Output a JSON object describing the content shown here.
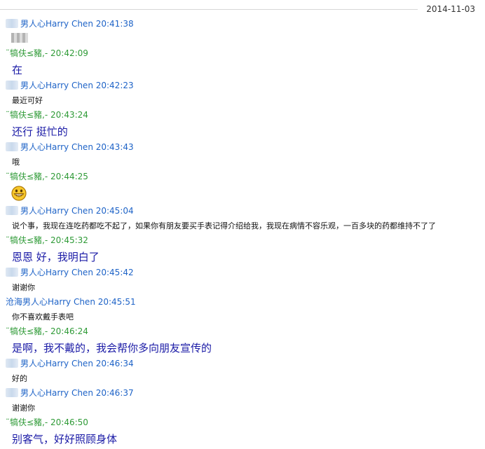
{
  "date": "2014-11-03",
  "contacts": {
    "them": "男人心Harry Chen",
    "them_full": "沧海男人心Harry Chen",
    "me": "¨犒伕≤豬,-"
  },
  "entries": [
    {
      "header": "男人心Harry Chen 20:41:38"
    },
    {
      "header": "¨犒伕≤豬,- 20:42:09",
      "text": "在"
    },
    {
      "header": "男人心Harry Chen 20:42:23",
      "text": "最近可好"
    },
    {
      "header": "¨犒伕≤豬,- 20:43:24",
      "text": "还行 挺忙的"
    },
    {
      "header": "男人心Harry Chen 20:43:43",
      "text": "哦"
    },
    {
      "header": "¨犒伕≤豬,- 20:44:25",
      "icon": "grinning-smiley-icon"
    },
    {
      "header": "男人心Harry Chen 20:45:04",
      "text": "说个事，我现在连吃药都吃不起了，如果你有朋友要买手表记得介绍给我，我现在病情不容乐观，一百多块的药都维持不了了"
    },
    {
      "header": "¨犒伕≤豬,- 20:45:32",
      "text": "恩恩 好，我明白了"
    },
    {
      "header": "男人心Harry Chen 20:45:42",
      "text": "谢谢你"
    },
    {
      "header": "沧海男人心Harry Chen 20:45:51",
      "text": "你不喜欢戴手表吧"
    },
    {
      "header": "¨犒伕≤豬,- 20:46:24",
      "text": "是啊，我不戴的，我会帮你多向朋友宣传的"
    },
    {
      "header": "男人心Harry Chen 20:46:34",
      "text": "好的"
    },
    {
      "header": "男人心Harry Chen 20:46:37",
      "text": "谢谢你"
    },
    {
      "header": "¨犒伕≤豬,- 20:46:50",
      "text": "别客气，好好照顾身体"
    }
  ]
}
